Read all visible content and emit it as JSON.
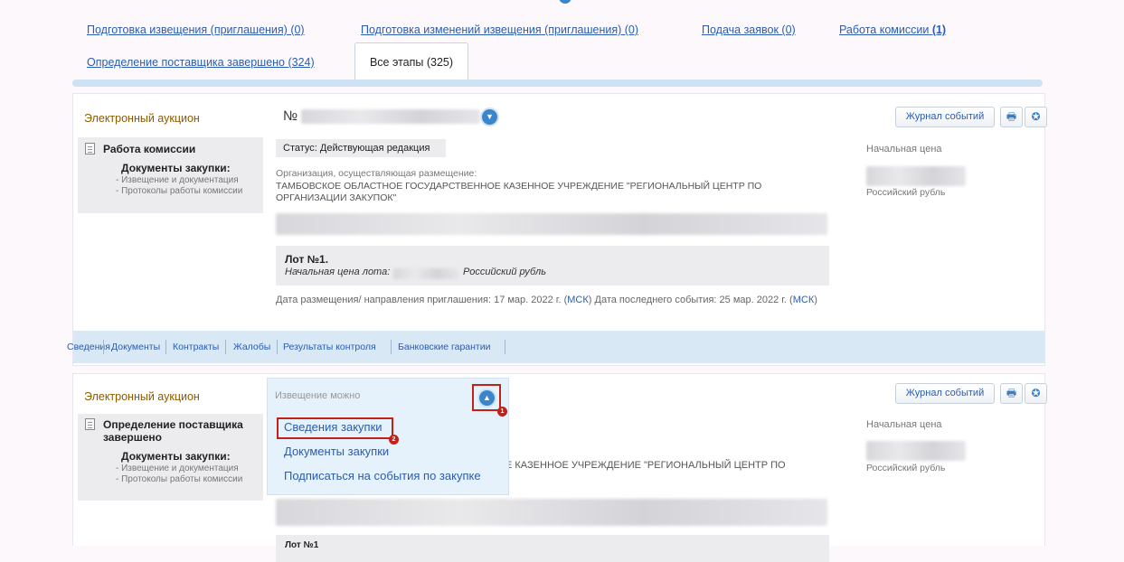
{
  "tabs": {
    "items": [
      {
        "label": "Подготовка извещения (приглашения) (0)"
      },
      {
        "label": "Подготовка изменений извещения (приглашения) (0)"
      },
      {
        "label": "Подача заявок (0)"
      },
      {
        "label": "Работа комиссии",
        "count": "(1)"
      },
      {
        "label": "Определение поставщика завершено (324)"
      }
    ],
    "active_label": "Все этапы (325)"
  },
  "card1": {
    "procedure_type": "Электронный аукцион",
    "number_prefix": "№",
    "stage": "Работа комиссии",
    "docs_title": "Документы закупки:",
    "docs_items": [
      "- Извещение и документация",
      "- Протоколы работы комиссии"
    ],
    "status_label": "Статус:",
    "status_value": "Действующая редакция",
    "org_label": "Организация, осуществляющая размещение:",
    "org_name": "ТАМБОВСКОЕ ОБЛАСТНОЕ ГОСУДАРСТВЕННОЕ КАЗЕННОЕ УЧРЕЖДЕНИЕ \"РЕГИОНАЛЬНЫЙ ЦЕНТР ПО ОРГАНИЗАЦИИ ЗАКУПОК\"",
    "lot_title": "Лот №1.",
    "lot_price_label": "Начальная цена лота:",
    "lot_currency": "Российский рубль",
    "dates_text_1": "Дата размещения/ направления приглашения: 17 мар. 2022 г. (",
    "dates_msk": "МСК",
    "dates_text_2": ") Дата последнего события: 25 мар. 2022 г. (",
    "dates_text_3": ")",
    "journal_button": "Журнал событий",
    "price_label": "Начальная цена",
    "currency": "Российский рубль",
    "nav": [
      "Сведения",
      "Документы",
      "Контракты",
      "Жалобы",
      "Результаты контроля",
      "Банковские гарантии"
    ]
  },
  "card2": {
    "procedure_type": "Электронный аукцион",
    "stage_line1": "Определение поставщика",
    "stage_line2": "завершено",
    "docs_title": "Документы закупки:",
    "docs_items": [
      "- Извещение и документация",
      "- Протоколы работы комиссии"
    ],
    "org_tail": "Е КАЗЕННОЕ УЧРЕЖДЕНИЕ \"РЕГИОНАЛЬНЫЙ ЦЕНТР ПО",
    "lot_partial": "Лот №1",
    "journal_button": "Журнал событий",
    "price_label": "Начальная цена",
    "currency": "Российский рубль",
    "dropdown": {
      "header": "Извещение можно",
      "items": [
        "Сведения закупки",
        "Документы закупки",
        "Подписаться на события по закупке"
      ]
    },
    "badges": [
      "1",
      "2"
    ]
  },
  "icons": {
    "print": "printer-icon",
    "badge": "medal-icon",
    "expand": "chevron-down-icon",
    "collapse": "chevron-up-icon",
    "document": "document-icon"
  },
  "colors": {
    "link": "#2a5db0",
    "procedure_type": "#8a5a00",
    "annotation_red": "#c0221a",
    "nav_bg": "#d8e8f5"
  }
}
